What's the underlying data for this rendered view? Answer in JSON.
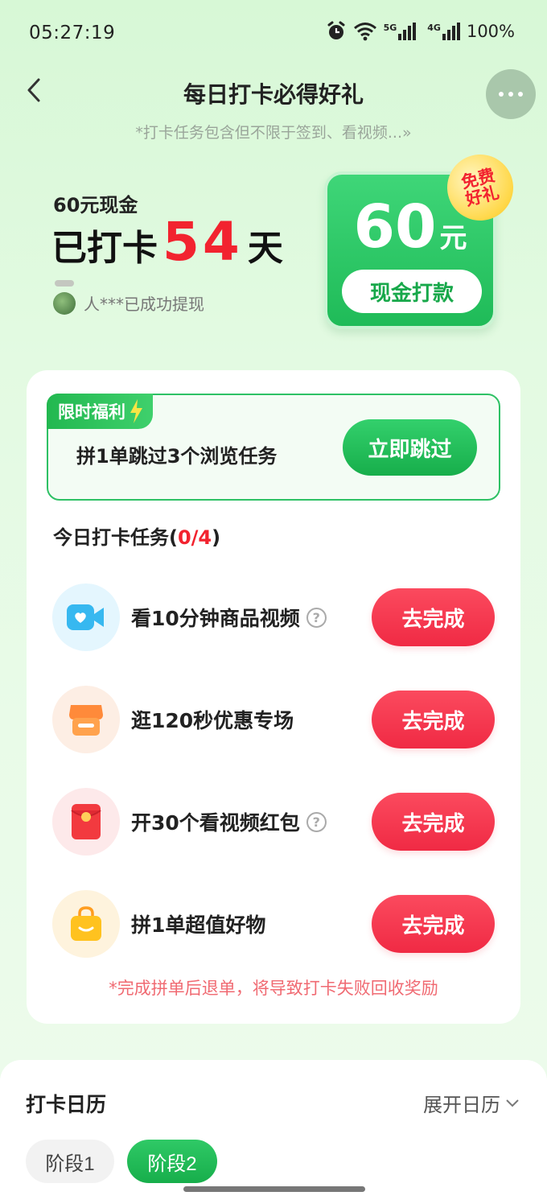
{
  "status_bar": {
    "time": "05:27:19",
    "network_5g": "5G",
    "network_4g": "4G",
    "battery": "100%"
  },
  "header": {
    "title": "每日打卡必得好礼",
    "subtitle": "*打卡任务包含但不限于签到、看视频...»"
  },
  "hero": {
    "cash_label": "60元现金",
    "days_prefix": "已打卡",
    "days_count": "54",
    "days_suffix": "天",
    "ticker_text": "人***已成功提现",
    "card_amount": "60",
    "card_unit": "元",
    "card_button": "现金打款",
    "badge_line1": "免费",
    "badge_line2": "好礼"
  },
  "promo": {
    "tag": "限时福利",
    "text": "拼1单跳过3个浏览任务",
    "button": "立即跳过"
  },
  "tasks": {
    "heading": "今日打卡任务",
    "progress_open": "(",
    "progress": "0/4",
    "progress_close": ")",
    "items": [
      {
        "label": "看10分钟商品视频",
        "has_help": true,
        "button": "去完成",
        "icon": "video-icon"
      },
      {
        "label": "逛120秒优惠专场",
        "has_help": false,
        "button": "去完成",
        "icon": "store-icon"
      },
      {
        "label": "开30个看视频红包",
        "has_help": true,
        "button": "去完成",
        "icon": "red-envelope-icon"
      },
      {
        "label": "拼1单超值好物",
        "has_help": false,
        "button": "去完成",
        "icon": "shopping-bag-icon"
      }
    ],
    "warning": "*完成拼单后退单，将导致打卡失败回收奖励",
    "help_glyph": "?"
  },
  "calendar": {
    "title": "打卡日历",
    "expand": "展开日历",
    "stages": [
      "阶段1",
      "阶段2"
    ]
  },
  "colors": {
    "accent_green": "#1fbb58",
    "accent_red": "#f02a44",
    "highlight_red": "#f2232f"
  }
}
